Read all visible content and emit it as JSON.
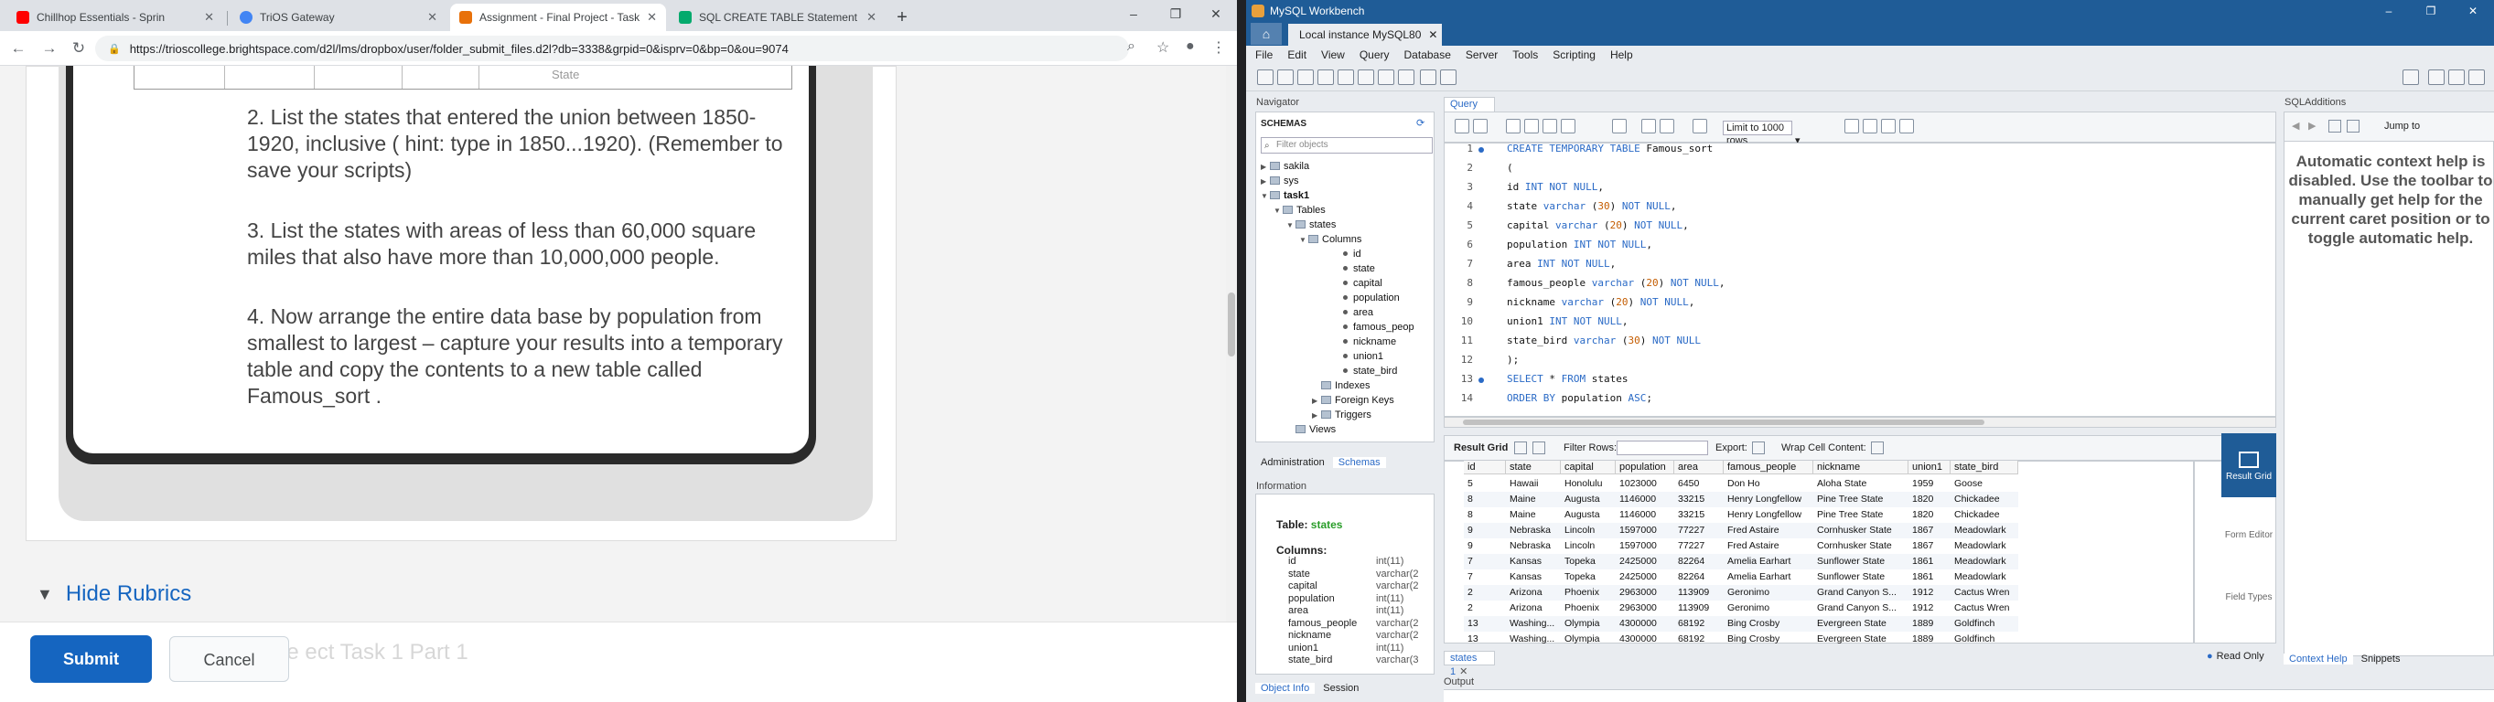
{
  "browser": {
    "tabs": [
      {
        "label": "Chillhop Essentials - Sprin",
        "color": "#ff0000"
      },
      {
        "label": "TriOS Gateway",
        "color": "#4285f4"
      },
      {
        "label": "Assignment - Final Project - Task",
        "color": "#e8710a"
      },
      {
        "label": "SQL CREATE TABLE Statement",
        "color": "#04aa6d"
      }
    ],
    "url": "https://trioscollege.brightspace.com/d2l/lms/dropbox/user/folder_submit_files.d2l?db=3338&grpid=0&isprv=0&bp=0&ou=9074"
  },
  "page": {
    "table_stub": {
      "col1": "",
      "col2": "State"
    },
    "instructions": [
      "2. List the states that entered the union between 1850-1920, inclusive ( hint: type in 1850...1920). (Remember to save your scripts)",
      "3. List the states with areas of less than 60,000 square miles that also have more than 10,000,000 people.",
      "4. Now arrange the entire data base by population from smallest to largest – capture your results into a temporary table and copy the contents to a new table called Famous_sort ."
    ],
    "hide_rubrics": "Hide Rubrics",
    "submit": "Submit",
    "cancel": "Cancel",
    "ghost": "ne ect Task 1 Part 1"
  },
  "workbench": {
    "title": "MySQL Workbench",
    "connection_tab": "Local instance MySQL80",
    "menu": [
      "File",
      "Edit",
      "View",
      "Query",
      "Database",
      "Server",
      "Tools",
      "Scripting",
      "Help"
    ],
    "navigator": {
      "header": "Navigator",
      "schemas_label": "SCHEMAS",
      "filter_placeholder": "Filter objects",
      "tree": [
        "sakila",
        "sys",
        "task1",
        "Tables",
        "states",
        "Columns",
        "id",
        "state",
        "capital",
        "population",
        "area",
        "famous_peop",
        "nickname",
        "union1",
        "state_bird",
        "Indexes",
        "Foreign Keys",
        "Triggers",
        "Views"
      ],
      "tabs": [
        "Administration",
        "Schemas"
      ]
    },
    "information": {
      "header": "Information",
      "table_label": "Table:",
      "table_name": "states",
      "columns_label": "Columns:",
      "columns": [
        [
          "id",
          "int(11)"
        ],
        [
          "state",
          "varchar(2"
        ],
        [
          "capital",
          "varchar(2"
        ],
        [
          "population",
          "int(11)"
        ],
        [
          "area",
          "int(11)"
        ],
        [
          "famous_people",
          "varchar(2"
        ],
        [
          "nickname",
          "varchar(2"
        ],
        [
          "union1",
          "int(11)"
        ],
        [
          "state_bird",
          "varchar(3"
        ]
      ],
      "tabs": [
        "Object Info",
        "Session"
      ]
    },
    "query_tab": "Query 1",
    "limit_label": "Limit to 1000 rows",
    "code": [
      "CREATE TEMPORARY TABLE Famous_sort",
      "(",
      "id INT NOT NULL,",
      "state varchar (30) NOT NULL,",
      "capital varchar (20) NOT NULL,",
      "population INT NOT NULL,",
      "area INT NOT NULL,",
      "famous_people varchar (20) NOT NULL,",
      "nickname varchar (20) NOT NULL,",
      "union1 INT NOT NULL,",
      "state_bird varchar (30) NOT NULL",
      ");",
      "SELECT * FROM states",
      "ORDER BY population ASC;"
    ],
    "line_numbers": [
      "1",
      "2",
      "3",
      "4",
      "5",
      "6",
      "7",
      "8",
      "9",
      "10",
      "11",
      "12",
      "13",
      "14"
    ],
    "sql_additions": {
      "header": "SQLAdditions",
      "jump": "Jump to",
      "message": "Automatic context help is disabled. Use the toolbar to manually get help for the current caret position or to toggle automatic help.",
      "tabs": [
        "Context Help",
        "Snippets"
      ]
    },
    "result": {
      "toolbar": {
        "grid": "Result Grid",
        "filter": "Filter Rows:",
        "export": "Export:",
        "wrap": "Wrap Cell Content:"
      },
      "headers": [
        "id",
        "state",
        "capital",
        "population",
        "area",
        "famous_people",
        "nickname",
        "union1",
        "state_bird"
      ],
      "rows": [
        [
          "5",
          "Hawaii",
          "Honolulu",
          "1023000",
          "6450",
          "Don Ho",
          "Aloha State",
          "1959",
          "Goose"
        ],
        [
          "8",
          "Maine",
          "Augusta",
          "1146000",
          "33215",
          "Henry Longfellow",
          "Pine Tree State",
          "1820",
          "Chickadee"
        ],
        [
          "8",
          "Maine",
          "Augusta",
          "1146000",
          "33215",
          "Henry Longfellow",
          "Pine Tree State",
          "1820",
          "Chickadee"
        ],
        [
          "9",
          "Nebraska",
          "Lincoln",
          "1597000",
          "77227",
          "Fred Astaire",
          "Cornhusker State",
          "1867",
          "Meadowlark"
        ],
        [
          "9",
          "Nebraska",
          "Lincoln",
          "1597000",
          "77227",
          "Fred Astaire",
          "Cornhusker State",
          "1867",
          "Meadowlark"
        ],
        [
          "7",
          "Kansas",
          "Topeka",
          "2425000",
          "82264",
          "Amelia Earhart",
          "Sunflower State",
          "1861",
          "Meadowlark"
        ],
        [
          "7",
          "Kansas",
          "Topeka",
          "2425000",
          "82264",
          "Amelia Earhart",
          "Sunflower State",
          "1861",
          "Meadowlark"
        ],
        [
          "2",
          "Arizona",
          "Phoenix",
          "2963000",
          "113909",
          "Geronimo",
          "Grand Canyon S...",
          "1912",
          "Cactus Wren"
        ],
        [
          "2",
          "Arizona",
          "Phoenix",
          "2963000",
          "113909",
          "Geronimo",
          "Grand Canyon S...",
          "1912",
          "Cactus Wren"
        ],
        [
          "13",
          "Washing...",
          "Olympia",
          "4300000",
          "68192",
          "Bing Crosby",
          "Evergreen State",
          "1889",
          "Goldfinch"
        ],
        [
          "13",
          "Washing...",
          "Olympia",
          "4300000",
          "68192",
          "Bing Crosby",
          "Evergreen State",
          "1889",
          "Goldfinch"
        ]
      ],
      "side": [
        "Result Grid",
        "Form Editor",
        "Field Types"
      ],
      "tab": "states 1",
      "readonly": "Read Only"
    },
    "output": "Output"
  }
}
